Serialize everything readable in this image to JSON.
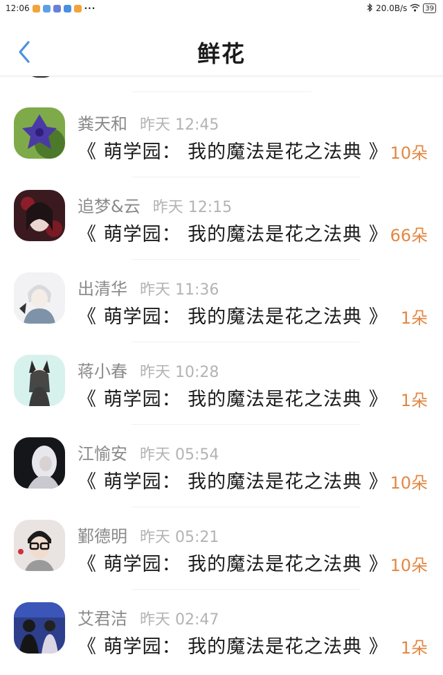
{
  "status_bar": {
    "time": "12:06",
    "dots": "···",
    "network_speed": "20.0B/s",
    "battery": "39",
    "icons": [
      "weibo-icon",
      "cloud-icon",
      "app-icon",
      "app-icon",
      "weibo-icon",
      "bluetooth-icon",
      "wifi-icon"
    ]
  },
  "header": {
    "title": "鲜花",
    "back_icon": "chevron-left-icon"
  },
  "colors": {
    "accent": "#4a90e2",
    "amount": "#e38742",
    "name": "#8a8a8a",
    "time": "#b3b3b3"
  },
  "items": [
    {
      "name": "粪天和",
      "time": "昨天 12:45",
      "title": "《 萌学园： 我的魔法是花之法典 》",
      "amount": "10朵"
    },
    {
      "name": "追梦&云",
      "time": "昨天 12:15",
      "title": "《 萌学园： 我的魔法是花之法典 》",
      "amount": "66朵"
    },
    {
      "name": "出清华",
      "time": "昨天 11:36",
      "title": "《 萌学园： 我的魔法是花之法典 》",
      "amount": "1朵"
    },
    {
      "name": "蒋小春",
      "time": "昨天 10:28",
      "title": "《 萌学园： 我的魔法是花之法典 》",
      "amount": "1朵"
    },
    {
      "name": "江愉安",
      "time": "昨天 05:54",
      "title": "《 萌学园： 我的魔法是花之法典 》",
      "amount": "10朵"
    },
    {
      "name": "鄞德明",
      "time": "昨天 05:21",
      "title": "《 萌学园： 我的魔法是花之法典 》",
      "amount": "10朵"
    },
    {
      "name": "艾君洁",
      "time": "昨天 02:47",
      "title": "《 萌学园： 我的魔法是花之法典 》",
      "amount": "1朵"
    }
  ]
}
